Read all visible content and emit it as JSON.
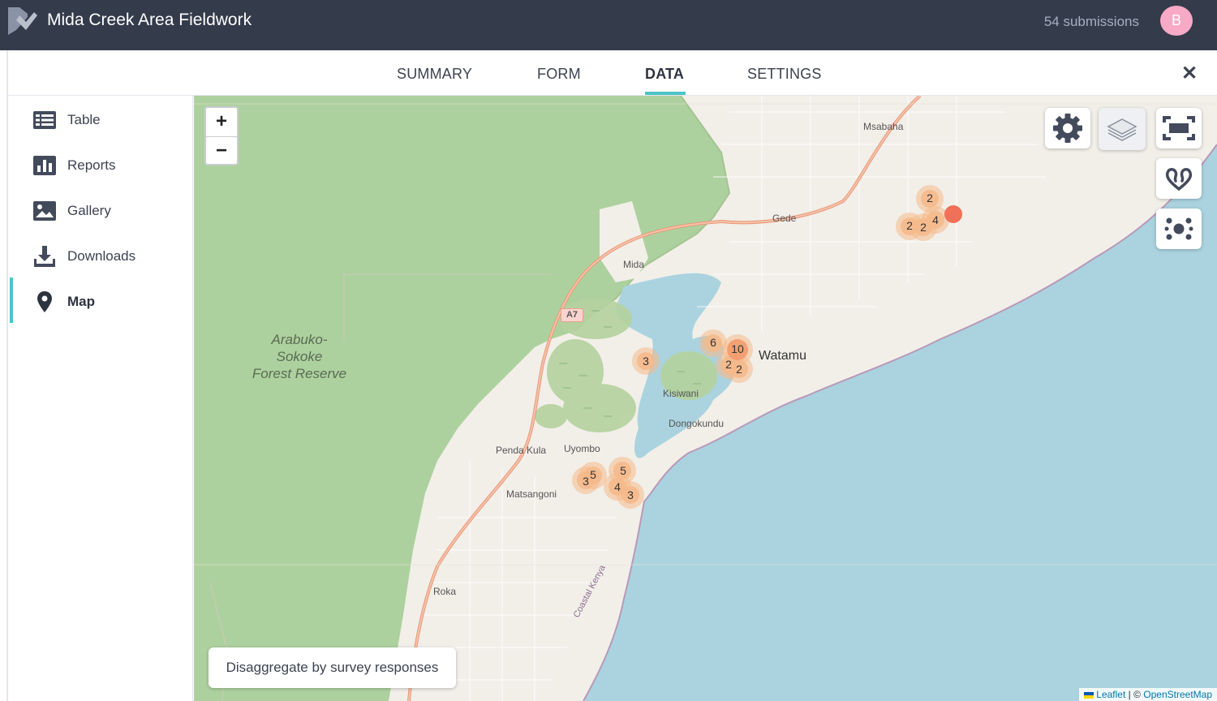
{
  "header": {
    "title": "Mida Creek Area Fieldwork",
    "submissions": "54 submissions",
    "avatar_initial": "B"
  },
  "tabs": [
    {
      "label": "SUMMARY",
      "active": false
    },
    {
      "label": "FORM",
      "active": false
    },
    {
      "label": "DATA",
      "active": true
    },
    {
      "label": "SETTINGS",
      "active": false
    }
  ],
  "sidebar": {
    "items": [
      {
        "label": "Table",
        "icon": "table-icon"
      },
      {
        "label": "Reports",
        "icon": "bar-chart-icon"
      },
      {
        "label": "Gallery",
        "icon": "image-icon"
      },
      {
        "label": "Downloads",
        "icon": "download-icon"
      },
      {
        "label": "Map",
        "icon": "map-pin-icon",
        "active": true
      }
    ]
  },
  "map": {
    "zoom_in": "+",
    "zoom_out": "−",
    "disaggregate_button": "Disaggregate by survey responses",
    "attribution": {
      "leaflet": "Leaflet",
      "separator": " | © ",
      "osm": "OpenStreetMap"
    },
    "reserve_label": [
      "Arabuko-",
      "Sokoke",
      "Forest Reserve"
    ],
    "places": [
      "Msabaha",
      "Gede",
      "Mida",
      "Watamu",
      "Kisiwani",
      "Dongokundu",
      "Penda Kula",
      "Uyombo",
      "Matsangoni",
      "Roka"
    ],
    "road_ref": "A7",
    "coastal_road": "Coastal Kenya",
    "clusters": [
      "2",
      "2",
      "2",
      "4",
      "6",
      "10",
      "2",
      "2",
      "3",
      "5",
      "3",
      "5",
      "4",
      "3"
    ],
    "colors": {
      "water": "#aad3df",
      "forest": "#add19e",
      "land": "#f2efe9",
      "cluster": "#f5b98a",
      "marker": "#f07058"
    }
  },
  "colors": {
    "header_bg": "#343b4b",
    "accent": "#4bc4c6",
    "avatar": "#f7a9c6"
  }
}
